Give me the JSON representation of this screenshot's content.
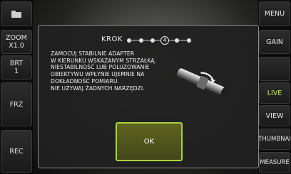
{
  "left_panel": {
    "folder_icon": "folder-icon",
    "zoom": {
      "label": "ZOOM",
      "value": "X1.0"
    },
    "brightness": {
      "label": "BRT",
      "value": "1"
    },
    "freeze_label": "FRZ",
    "record_label": "REC"
  },
  "right_panel": {
    "menu_label": "MENU",
    "gain_label": "GAIN",
    "live_label": "LIVE",
    "view_label": "VIEW",
    "thumbnail_label": "THUMBNAI",
    "measure_label": "MEASURE"
  },
  "dialog": {
    "step_label": "KROK",
    "step_current": "4",
    "step_total": 6,
    "instruction": "ZAMOCUJ STABILNIE ADAPTER\nW KIERUNKU WSKAZANYM STRZAŁKĄ.\nNIESTABILNOŚĆ LUB POLUZOWANIE\nOBIEKTYWU WPŁYNIE UJEMNIE NA\nDOKŁADNOŚĆ POMIARU.\nNIE UŻYWAJ ŻADNYCH NARZĘDZI.",
    "ok_label": "OK"
  },
  "colors": {
    "accent": "#c6e84a",
    "ok_border": "#a9d040",
    "ok_fill": "#52571e"
  }
}
